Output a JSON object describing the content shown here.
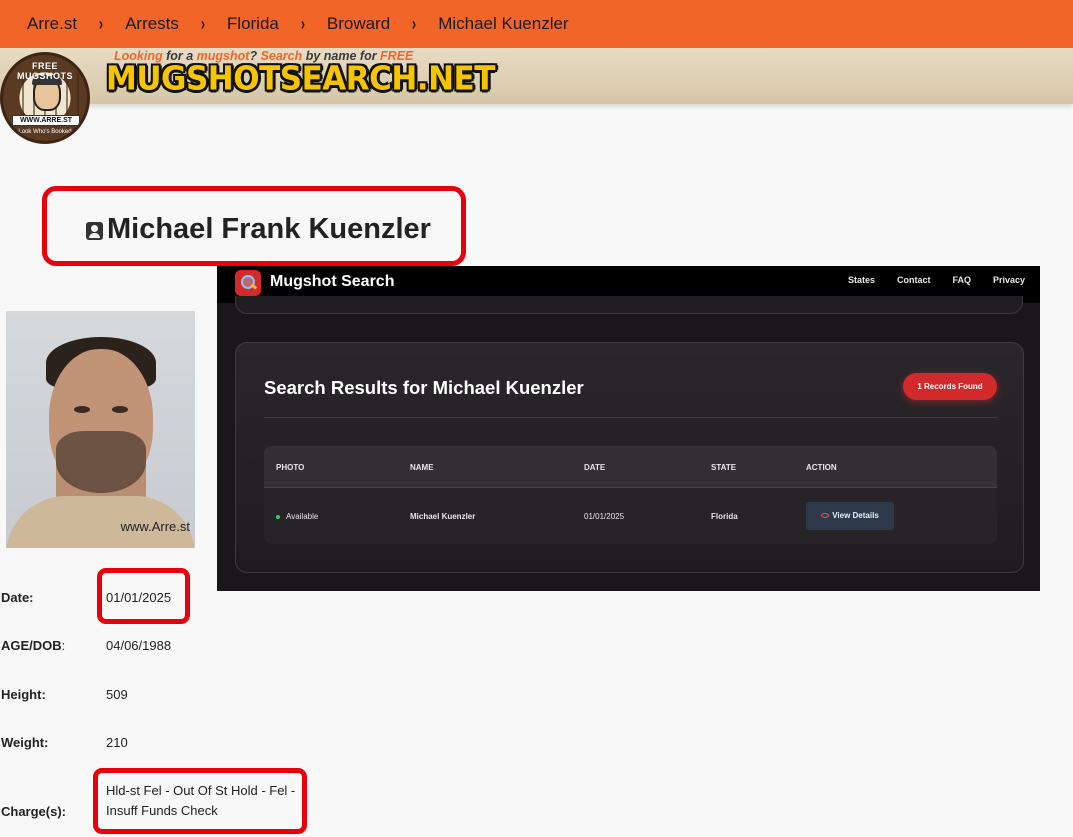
{
  "breadcrumb": {
    "items": [
      "Arre.st",
      "Arrests",
      "Florida",
      "Broward",
      "Michael Kuenzler"
    ],
    "separator": "›"
  },
  "banner": {
    "logo_top": "FREE MUGSHOTS",
    "logo_url": "WWW.ARRE.ST",
    "logo_tagline": "Look Who's Booked",
    "tagline_parts": [
      "Looking",
      " for a ",
      "mugshot",
      "? ",
      "Search",
      " by name for ",
      "FREE"
    ],
    "brand": "MUGSHOTSEARCH.NET"
  },
  "profile": {
    "name": "Michael Frank Kuenzler",
    "photo_watermark": "www.Arre.st",
    "fields": {
      "date_label": "Date:",
      "date": "01/01/2025",
      "age_label": "AGE/DOB",
      "age_colon": ":",
      "dob": "04/06/1988",
      "height_label": "Height:",
      "height": "509",
      "weight_label": "Weight:",
      "weight": "210",
      "charges_label": "Charge(s):",
      "charges": "Hld-st Fel - Out Of St Hold - Fel - Insuff Funds Check"
    }
  },
  "embedded": {
    "site_title": "Mugshot Search",
    "nav": [
      "States",
      "Contact",
      "FAQ",
      "Privacy"
    ],
    "heading": "Search Results for Michael Kuenzler",
    "badge": "1 Records Found",
    "columns": [
      "PHOTO",
      "NAME",
      "DATE",
      "STATE",
      "ACTION"
    ],
    "row": {
      "photo": "Available",
      "name": "Michael Kuenzler",
      "date": "01/01/2025",
      "state": "Florida",
      "action": "View Details"
    }
  },
  "colors": {
    "accent_orange": "#f26529",
    "highlight_red": "#e8000b",
    "badge_red": "#d22a2a",
    "status_green": "#2ecc71"
  },
  "icons": [
    "chevron-right-icon",
    "person-card-icon",
    "magnifier-logo-icon",
    "eye-icon",
    "status-dot-icon"
  ]
}
